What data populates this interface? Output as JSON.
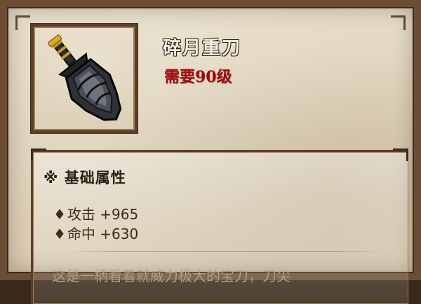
{
  "item": {
    "name": "碎月重刀",
    "requirement": "需要90级",
    "icon": "broadsword-icon"
  },
  "attributes": {
    "title": "※ 基础属性",
    "stats": [
      {
        "bullet": "♦",
        "text": "攻击 +965"
      },
      {
        "bullet": "♦",
        "text": "命中 +630"
      }
    ]
  },
  "description": "这是一柄看着就威力极大的宝刀，刀尖",
  "colors": {
    "requirement": "#a1080a",
    "name": "#f7f1e6",
    "parchment": "#dfd3bc",
    "frame": "#6b4e34",
    "description": "#b39d86"
  }
}
